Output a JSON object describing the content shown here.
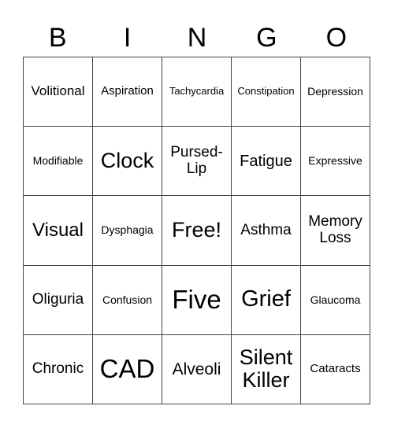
{
  "header": {
    "letters": [
      "B",
      "I",
      "N",
      "G",
      "O"
    ]
  },
  "board": {
    "rows": [
      [
        "Volitional",
        "Aspiration",
        "Tachycardia",
        "Constipation",
        "Depression"
      ],
      [
        "Modifiable",
        "Clock",
        "Pursed-Lip",
        "Fatigue",
        "Expressive"
      ],
      [
        "Visual",
        "Dysphagia",
        "Free!",
        "Asthma",
        "Memory Loss"
      ],
      [
        "Oliguria",
        "Confusion",
        "Five",
        "Grief",
        "Glaucoma"
      ],
      [
        "Chronic",
        "CAD",
        "Alveoli",
        "Silent Killer",
        "Cataracts"
      ]
    ]
  }
}
